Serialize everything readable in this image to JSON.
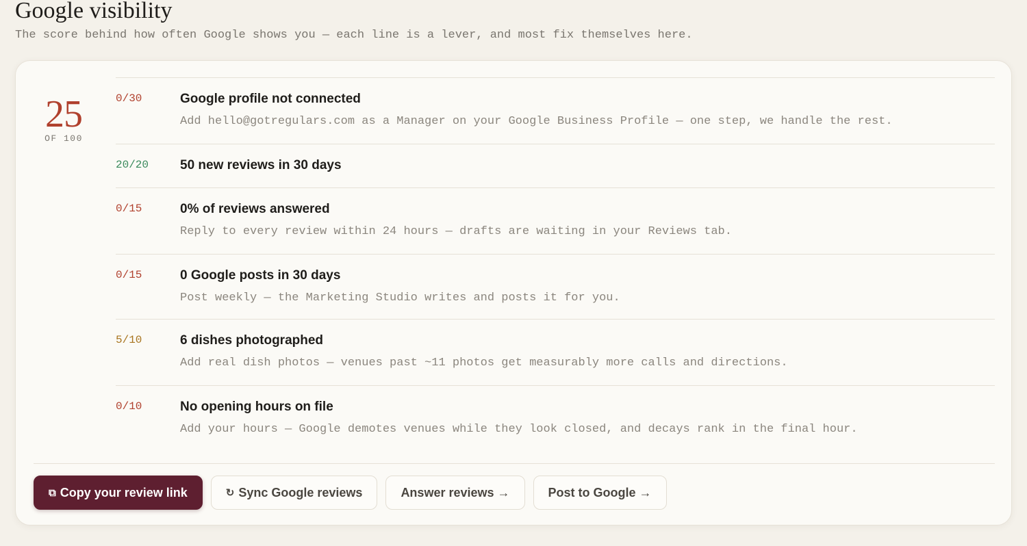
{
  "header": {
    "title": "Google visibility",
    "subtitle": "The score behind how often Google shows you — each line is a lever, and most fix themselves here."
  },
  "score": {
    "value": "25",
    "suffix": "OF 100",
    "color": "#b0402d"
  },
  "items": [
    {
      "points": "0/30",
      "status": "bad",
      "title": "Google profile not connected",
      "description": "Add hello@gotregulars.com as a Manager on your Google Business Profile — one step, we handle the rest."
    },
    {
      "points": "20/20",
      "status": "good",
      "title": "50 new reviews in 30 days",
      "description": ""
    },
    {
      "points": "0/15",
      "status": "bad",
      "title": "0% of reviews answered",
      "description": "Reply to every review within 24 hours — drafts are waiting in your Reviews tab."
    },
    {
      "points": "0/15",
      "status": "bad",
      "title": "0 Google posts in 30 days",
      "description": "Post weekly — the Marketing Studio writes and posts it for you."
    },
    {
      "points": "5/10",
      "status": "mid",
      "title": "6 dishes photographed",
      "description": "Add real dish photos — venues past ~11 photos get measurably more calls and directions."
    },
    {
      "points": "0/10",
      "status": "bad",
      "title": "No opening hours on file",
      "description": "Add your hours — Google demotes venues while they look closed, and decays rank in the final hour."
    }
  ],
  "actions": {
    "copy_link": {
      "label": "Copy your review link",
      "icon": "copy-icon"
    },
    "sync_reviews": {
      "label": "Sync Google reviews",
      "icon": "refresh-icon"
    },
    "answer_reviews": {
      "label": "Answer reviews →"
    },
    "post_google": {
      "label": "Post to Google →"
    }
  },
  "colors": {
    "bad": "#b0402d",
    "good": "#3a8a5c",
    "mid": "#a8741f",
    "primary": "#5e1f30"
  }
}
